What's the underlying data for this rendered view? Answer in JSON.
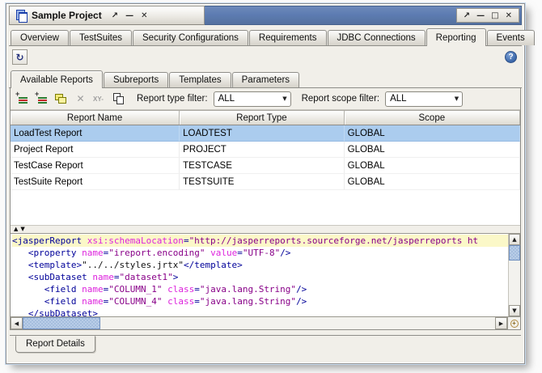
{
  "window": {
    "title": "Sample Project",
    "inner_controls": [
      {
        "name": "float",
        "glyph": "↗"
      },
      {
        "name": "minimize",
        "glyph": "—"
      },
      {
        "name": "close",
        "glyph": "✕"
      }
    ],
    "outer_controls": [
      {
        "name": "float",
        "glyph": "↗"
      },
      {
        "name": "minimize",
        "glyph": "—"
      },
      {
        "name": "maximize",
        "glyph": "□"
      },
      {
        "name": "close",
        "glyph": "✕"
      }
    ]
  },
  "main_tabs": {
    "items": [
      "Overview",
      "TestSuites",
      "Security Configurations",
      "Requirements",
      "JDBC Connections",
      "Reporting",
      "Events"
    ],
    "active": 5
  },
  "header_toolbar": {
    "refresh_glyph": "↻",
    "help_glyph": "?"
  },
  "sub_tabs": {
    "items": [
      "Available Reports",
      "Subreports",
      "Templates",
      "Parameters"
    ],
    "active": 0
  },
  "report_toolbar": {
    "icons": [
      {
        "name": "add-report-icon",
        "type": "addlines"
      },
      {
        "name": "add-subreport-icon",
        "type": "addlines"
      },
      {
        "name": "clone-report-icon",
        "type": "folders"
      },
      {
        "name": "delete-report-icon",
        "type": "xmark",
        "glyph": "✕"
      },
      {
        "name": "rename-report-icon",
        "type": "xytext",
        "glyph": "XY-"
      },
      {
        "name": "copy-report-icon",
        "type": "squares"
      }
    ],
    "type_filter_label": "Report type filter:",
    "type_filter_value": "ALL",
    "scope_filter_label": "Report scope filter:",
    "scope_filter_value": "ALL",
    "combo_arrow": "▼"
  },
  "table": {
    "columns": [
      "Report Name",
      "Report Type",
      "Scope"
    ],
    "rows": [
      {
        "name": "LoadTest Report",
        "type": "LOADTEST",
        "scope": "GLOBAL",
        "selected": true
      },
      {
        "name": "Project Report",
        "type": "PROJECT",
        "scope": "GLOBAL",
        "selected": false
      },
      {
        "name": "TestCase Report",
        "type": "TESTCASE",
        "scope": "GLOBAL",
        "selected": false
      },
      {
        "name": "TestSuite Report",
        "type": "TESTSUITE",
        "scope": "GLOBAL",
        "selected": false
      }
    ]
  },
  "splitter": {
    "up_glyph": "▲",
    "down_glyph": "▼"
  },
  "editor": {
    "lines": [
      {
        "hl": true,
        "tokens": [
          [
            "t",
            "<jasperReport "
          ],
          [
            "a",
            "xsi:schemaLocation"
          ],
          [
            "t",
            "="
          ],
          [
            "s",
            "\"http://jasperreports.sourceforge.net/jasperreports ht"
          ]
        ]
      },
      {
        "hl": false,
        "tokens": [
          [
            "p",
            "   "
          ],
          [
            "t",
            "<property "
          ],
          [
            "a",
            "name"
          ],
          [
            "t",
            "="
          ],
          [
            "s",
            "\"ireport.encoding\""
          ],
          [
            "p",
            " "
          ],
          [
            "a",
            "value"
          ],
          [
            "t",
            "="
          ],
          [
            "s",
            "\"UTF-8\""
          ],
          [
            "t",
            "/>"
          ]
        ]
      },
      {
        "hl": false,
        "tokens": [
          [
            "p",
            "   "
          ],
          [
            "t",
            "<template>"
          ],
          [
            "p",
            "\"../../styles.jrtx\""
          ],
          [
            "t",
            "</template>"
          ]
        ]
      },
      {
        "hl": false,
        "tokens": [
          [
            "p",
            "   "
          ],
          [
            "t",
            "<subDataset "
          ],
          [
            "a",
            "name"
          ],
          [
            "t",
            "="
          ],
          [
            "s",
            "\"dataset1\""
          ],
          [
            "t",
            ">"
          ]
        ]
      },
      {
        "hl": false,
        "tokens": [
          [
            "p",
            "      "
          ],
          [
            "t",
            "<field "
          ],
          [
            "a",
            "name"
          ],
          [
            "t",
            "="
          ],
          [
            "s",
            "\"COLUMN_1\""
          ],
          [
            "p",
            " "
          ],
          [
            "a",
            "class"
          ],
          [
            "t",
            "="
          ],
          [
            "s",
            "\"java.lang.String\""
          ],
          [
            "t",
            "/>"
          ]
        ]
      },
      {
        "hl": false,
        "tokens": [
          [
            "p",
            "      "
          ],
          [
            "t",
            "<field "
          ],
          [
            "a",
            "name"
          ],
          [
            "t",
            "="
          ],
          [
            "s",
            "\"COLUMN_4\""
          ],
          [
            "p",
            " "
          ],
          [
            "a",
            "class"
          ],
          [
            "t",
            "="
          ],
          [
            "s",
            "\"java.lang.String\""
          ],
          [
            "t",
            "/>"
          ]
        ]
      },
      {
        "hl": false,
        "tokens": [
          [
            "p",
            "   "
          ],
          [
            "t",
            "</subDataset>"
          ]
        ]
      }
    ]
  },
  "scrollbars": {
    "up": "▲",
    "down": "▼",
    "left": "◀",
    "right": "▶",
    "magnifier_glyph": "+"
  },
  "bottom_tabs": {
    "items": [
      "Report Details"
    ],
    "active": 0
  },
  "colors": {
    "titlebar_blue": "#5d7cb2",
    "selection_blue": "#abccee",
    "line_highlight": "#fbf8c8",
    "xml_tag": "#000099",
    "xml_attr": "#dd22dd",
    "xml_string": "#880088"
  }
}
